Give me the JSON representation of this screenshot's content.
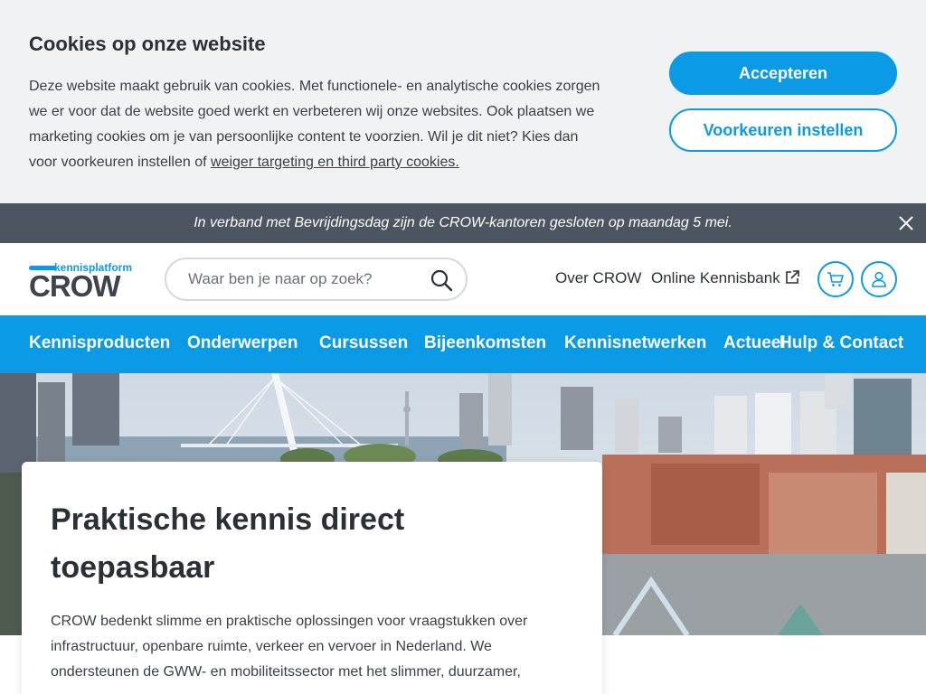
{
  "cookie": {
    "title": "Cookies op onze website",
    "text": "Deze website maakt gebruik van cookies. Met functionele- en analytische cookies zorgen we er voor dat de website goed werkt en verbeteren wij onze websites. Ook plaatsen we marketing cookies om je van persoonlijke content te voorzien. Wil je dit niet? Kies dan voor voorkeuren instellen of",
    "link": "weiger targeting en third party cookies.",
    "accept_label": "Accepteren",
    "prefs_label": "Voorkeuren instellen"
  },
  "notice": {
    "text": "In verband met Bevrijdingsdag zijn de CROW-kantoren gesloten op maandag 5 mei."
  },
  "header": {
    "logo_sub": "kennisplatform",
    "logo_main": "CROW",
    "search_placeholder": "Waar ben je naar op zoek?",
    "links": [
      "Over CROW",
      "Online Kennisbank"
    ]
  },
  "nav": {
    "items": [
      "Kennisproducten",
      "Onderwerpen",
      "Cursussen",
      "Bijeenkomsten",
      "Kennisnetwerken",
      "Actueel",
      "Hulp & Contact"
    ]
  },
  "hero": {
    "title": "Praktische kennis direct toepasbaar",
    "text": "CROW bedenkt slimme en praktische oplossingen voor vraagstukken over infrastructuur, openbare ruimte, verkeer en vervoer in Nederland. We ondersteunen de GWW- en mobiliteitssector met het slimmer, duurzamer,"
  },
  "colors": {
    "brand_blue": "#0a9ae6",
    "notice_bg": "#4d5560",
    "cookie_bg": "#f1f2f4"
  },
  "icons": [
    "search-icon",
    "close-icon",
    "external-link-icon",
    "cart-icon",
    "user-icon"
  ]
}
